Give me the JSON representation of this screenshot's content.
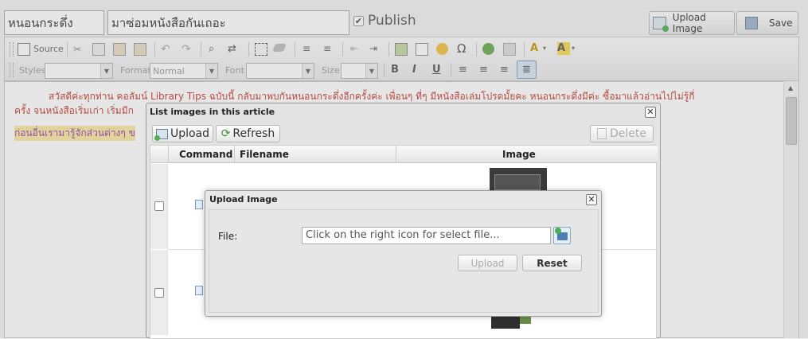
{
  "form": {
    "title_value": "หนอนกระดึ่ง",
    "subtitle_value": "มาซ่อมหนังสือกันเถอะ",
    "publish_label": "Publish",
    "publish_checked": true,
    "upload_image_label": "Upload Image",
    "save_label": "Save"
  },
  "toolbar": {
    "source_label": "Source",
    "styles_label": "Styles",
    "format_label": "Format",
    "format_value": "Normal",
    "font_label": "Font",
    "size_label": "Size",
    "bold": "B",
    "italic": "I",
    "underline": "U"
  },
  "editor": {
    "line1": "สวัสดีค่ะทุกท่าน คอลัมน์ Library Tips ฉบับนี้ กลับมาพบกันหนอนกระดึ่งอีกครั้งค่ะ เพื่อนๆ ที่ๆ มีหนังสือเล่มโปรดมั้ยคะ หนอนกระดึ่งมีค่ะ ซื้อมาแล้วอ่านไปไม่รู้กี่",
    "line2": "ครั้ง จนหนังสือเริ่มเก่า เริ่มมีก",
    "line3": "ก่อนอื่นเรามารู้จักส่วนต่างๆ ข"
  },
  "images_dialog": {
    "title": "List images in this article",
    "upload_label": "Upload",
    "refresh_label": "Refresh",
    "delete_label": "Delete",
    "columns": [
      "Command",
      "Filename",
      "Image"
    ]
  },
  "upload_dialog": {
    "title": "Upload Image",
    "file_label": "File:",
    "file_placeholder": "Click on the right icon for select file...",
    "upload_label": "Upload",
    "reset_label": "Reset"
  },
  "colors": {
    "editor_text": "#c0392b",
    "highlight_bg": "#f9e79f",
    "highlight_text": "#8e44ad"
  }
}
